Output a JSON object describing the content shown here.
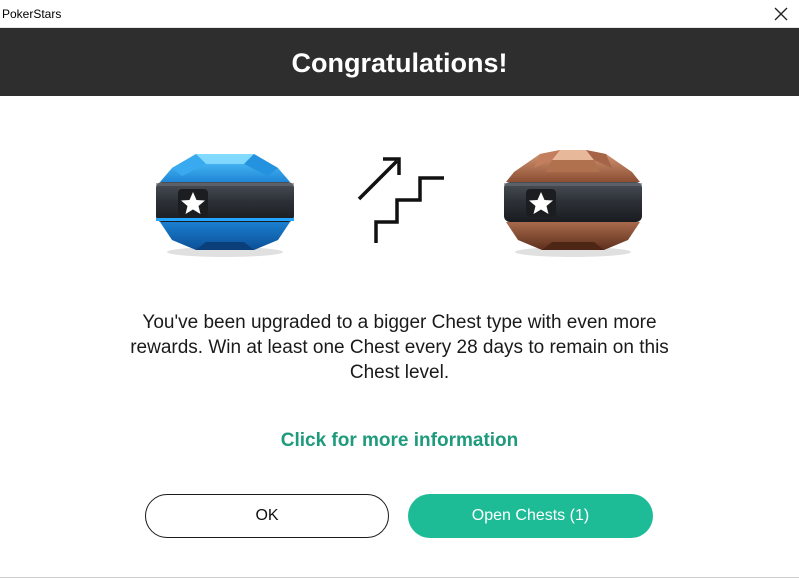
{
  "window": {
    "title": "PokerStars",
    "close_icon": "close-icon"
  },
  "header": {
    "title": "Congratulations!",
    "background": "#2e2e2e"
  },
  "illustration": {
    "from_chest": "blue-chest-icon",
    "transition": "upgrade-stairs-icon",
    "to_chest": "bronze-chest-icon"
  },
  "message": "You've been upgraded to a bigger Chest type with even more rewards. Win at least one Chest every 28 days to remain on this Chest level.",
  "info_link": "Click for more information",
  "buttons": {
    "ok": "OK",
    "open_chests": "Open Chests (1)"
  },
  "colors": {
    "accent": "#1dbc96",
    "link": "#1e9a7c"
  }
}
